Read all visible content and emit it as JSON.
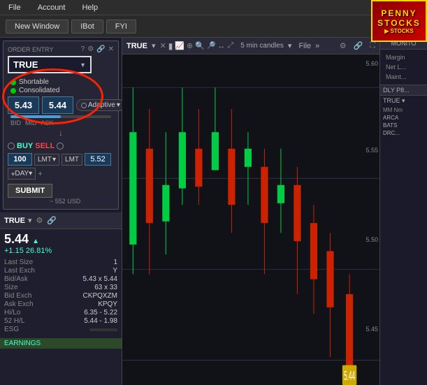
{
  "menu": {
    "items": [
      "File",
      "Account",
      "Help"
    ]
  },
  "penny_stocks": {
    "line1": "PENNY",
    "line2": "STOCKS"
  },
  "toolbar": {
    "new_window": "New Window",
    "ibot": "IBot",
    "fyi": "FYI"
  },
  "order_entry": {
    "title": "ORDER ENTRY",
    "ticker": "TRUE",
    "bid_price": "5.43",
    "ask_price": "5.44",
    "adaptive_label": "Adaptive",
    "bid_label": "BID",
    "mid_label": "MID",
    "ask_label": "ASK",
    "buy_label": "BUY",
    "sell_label": "SELL",
    "quantity": "100",
    "order_type1": "LMT",
    "order_type2": "LMT",
    "limit_price": "5.52",
    "duration": "DAY",
    "submit_label": "SUBMIT",
    "usd_estimate": "~ 552 USD",
    "shortable_label": "Shortable",
    "consolidated_label": "Consolidated"
  },
  "watchlist": {
    "ticker": "TRUE",
    "price": "5.44",
    "change": "+1.15",
    "change_pct": "26.81%",
    "details": [
      {
        "label": "Last Size",
        "value": "1"
      },
      {
        "label": "Last Exch",
        "value": "Y"
      },
      {
        "label": "Bid/Ask",
        "value": "5.43 x 5.44"
      },
      {
        "label": "Size",
        "value": "63 x 33"
      },
      {
        "label": "Bid Exch",
        "value": "CKPQXZM"
      },
      {
        "label": "Ask Exch",
        "value": "KPQY"
      },
      {
        "label": "Hi/Lo",
        "value": "6.35 - 5.22"
      },
      {
        "label": "52 H/L",
        "value": "5.44 - 1.98"
      },
      {
        "label": "ESG",
        "value": ""
      }
    ],
    "earnings_label": "EARNINGS"
  },
  "chart": {
    "ticker": "TRUE",
    "timeframe": "5 min candles",
    "file_label": "File",
    "price_levels": [
      "5.60",
      "5.55",
      "5.50",
      "5.45"
    ],
    "candles": [
      {
        "open": 5.52,
        "close": 5.58,
        "high": 5.6,
        "low": 5.5,
        "color": "green"
      },
      {
        "open": 5.57,
        "close": 5.53,
        "high": 5.59,
        "low": 5.5,
        "color": "red"
      },
      {
        "open": 5.54,
        "close": 5.56,
        "high": 5.58,
        "low": 5.51,
        "color": "green"
      },
      {
        "open": 5.55,
        "close": 5.58,
        "high": 5.6,
        "low": 5.53,
        "color": "green"
      },
      {
        "open": 5.57,
        "close": 5.55,
        "high": 5.59,
        "low": 5.53,
        "color": "red"
      },
      {
        "open": 5.56,
        "close": 5.58,
        "high": 5.6,
        "low": 5.55,
        "color": "green"
      },
      {
        "open": 5.57,
        "close": 5.54,
        "high": 5.59,
        "low": 5.52,
        "color": "red"
      },
      {
        "open": 5.55,
        "close": 5.57,
        "high": 5.58,
        "low": 5.53,
        "color": "green"
      },
      {
        "open": 5.56,
        "close": 5.53,
        "high": 5.57,
        "low": 5.5,
        "color": "red"
      },
      {
        "open": 5.54,
        "close": 5.56,
        "high": 5.57,
        "low": 5.52,
        "color": "green"
      },
      {
        "open": 5.55,
        "close": 5.52,
        "high": 5.56,
        "low": 5.49,
        "color": "red"
      },
      {
        "open": 5.53,
        "close": 5.5,
        "high": 5.54,
        "low": 5.48,
        "color": "red"
      },
      {
        "open": 5.51,
        "close": 5.48,
        "high": 5.52,
        "low": 5.45,
        "color": "red"
      },
      {
        "open": 5.49,
        "close": 5.44,
        "high": 5.5,
        "low": 5.43,
        "color": "red"
      }
    ]
  },
  "monitor": {
    "header": "MONITO",
    "margin_label": "Margin",
    "net_liq_label": "Net L...",
    "maint_label": "Maint...",
    "dly_label": "DLY P8...",
    "true_section_label": "TRUE",
    "mm_header_nm": "MM Nm",
    "mm_entries": [
      {
        "name": "ARCA"
      },
      {
        "name": "BATS"
      },
      {
        "name": "DRC..."
      }
    ]
  },
  "colors": {
    "green": "#00cc44",
    "red": "#cc2200",
    "accent_blue": "#4a9eda",
    "bg_dark": "#111118",
    "price_highlight": "#ffcc00"
  }
}
